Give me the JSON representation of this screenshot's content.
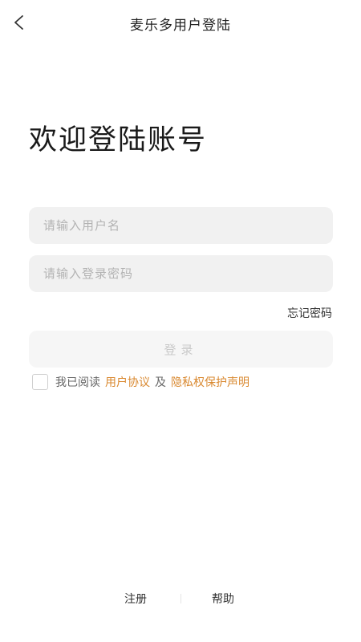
{
  "header": {
    "back_icon": "chevron-left-icon",
    "title": "麦乐多用户登陆"
  },
  "welcome": {
    "title": "欢迎登陆账号"
  },
  "form": {
    "username_placeholder": "请输入用户名",
    "username_value": "",
    "password_placeholder": "请输入登录密码",
    "password_value": "",
    "forgot_password": "忘记密码",
    "login_label": "登录"
  },
  "agreement": {
    "checked": false,
    "prefix": "我已阅读",
    "user_agreement": "用户协议",
    "conjunction": "及",
    "privacy_policy": "隐私权保护声明"
  },
  "footer": {
    "register": "注册",
    "help": "帮助"
  },
  "colors": {
    "link_accent": "#d9882f",
    "input_background": "#f1f1f1",
    "login_disabled_text": "#c9c9c9"
  }
}
